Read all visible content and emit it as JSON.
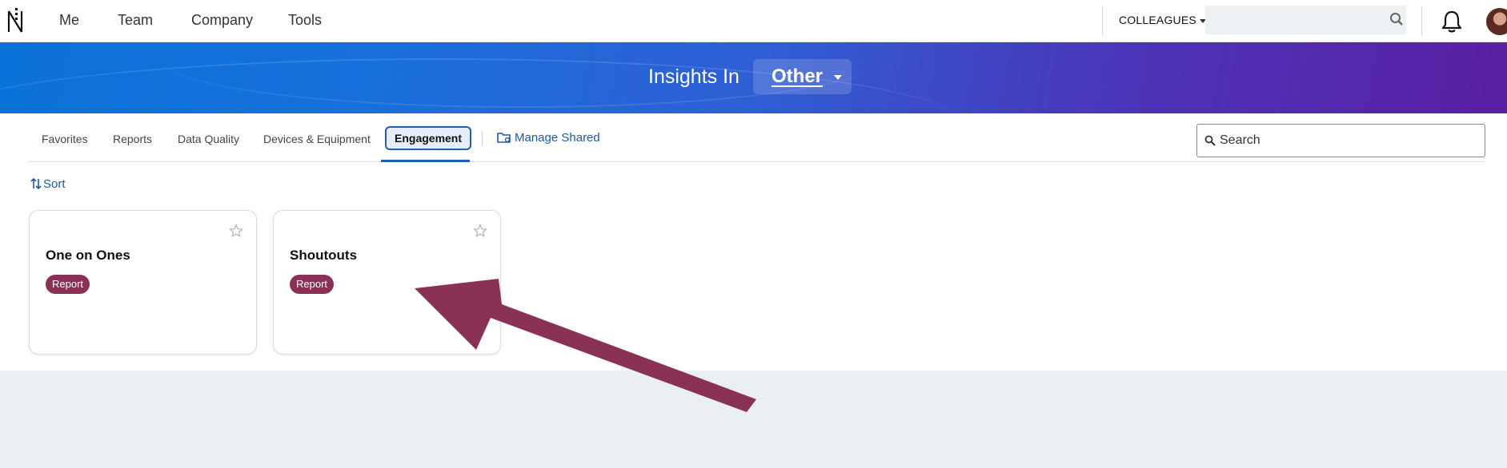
{
  "topnav": {
    "items": [
      "Me",
      "Team",
      "Company",
      "Tools"
    ],
    "colleagues_label": "COLLEAGUES",
    "search_placeholder": ""
  },
  "banner": {
    "label": "Insights In",
    "selected": "Other"
  },
  "tabs": {
    "items": [
      "Favorites",
      "Reports",
      "Data Quality",
      "Devices & Equipment"
    ],
    "active": "Engagement",
    "manage_shared": "Manage Shared",
    "search_placeholder": "Search"
  },
  "sort_label": "Sort",
  "cards": [
    {
      "title": "One on Ones",
      "badge": "Report"
    },
    {
      "title": "Shoutouts",
      "badge": "Report"
    }
  ],
  "colors": {
    "brand_blue": "#2160ad",
    "badge": "#8a3256",
    "arrow": "#8a3256"
  }
}
